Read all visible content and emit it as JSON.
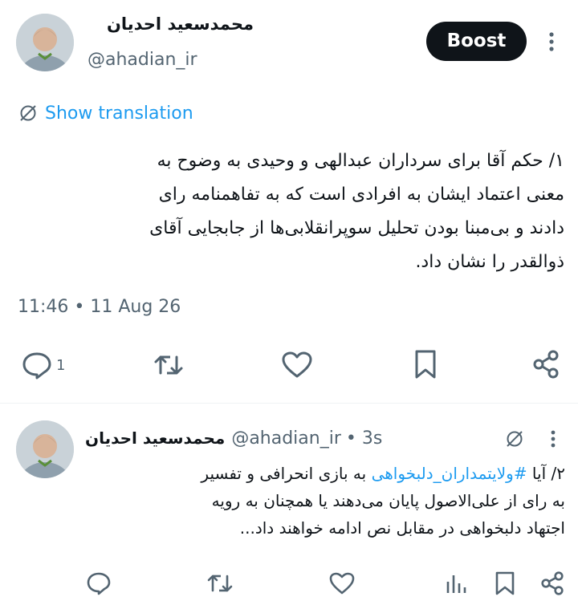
{
  "tweet1": {
    "author_name": "محمدسعید احدیان",
    "author_handle": "@ahadian_ir",
    "boost_label": "Boost",
    "translate_label": "Show translation",
    "text_lines": [
      "۱/ حکم آقا برای سرداران عبدالهی و وحیدی به وضوح به",
      "معنی اعتماد ایشان به افرادی است که به تفاهمنامه رای",
      "دادند و بی‌مبنا بودن تحلیل سوپرانقلابی‌ها از جابجایی آقای",
      "ذوالقدر را نشان داد."
    ],
    "timestamp": "11:46 • 11 Aug 26",
    "reply_count": "1",
    "icons": [
      "more-icon",
      "translate-icon",
      "reply-icon",
      "retweet-icon",
      "like-icon",
      "bookmark-icon",
      "share-icon"
    ]
  },
  "tweet2": {
    "author_name": "محمدسعید احدیان",
    "author_handle": "@ahadian_ir",
    "age": "• 3s",
    "line1_pre": "۲/ آیا ",
    "hashtag": "#ولایتمداران_دلبخواهی",
    "line1_post": " به بازی انحرافی و تفسیر",
    "line2": "به رای از علی‌الاصول پایان می‌دهند یا همچنان به رویه",
    "line3": "اجتهاد دلبخواهی در مقابل نص ادامه خواهند داد...",
    "icons": [
      "translate-icon",
      "more-icon",
      "reply-icon",
      "retweet-icon",
      "like-icon",
      "views-icon",
      "bookmark-icon",
      "share-icon"
    ]
  }
}
